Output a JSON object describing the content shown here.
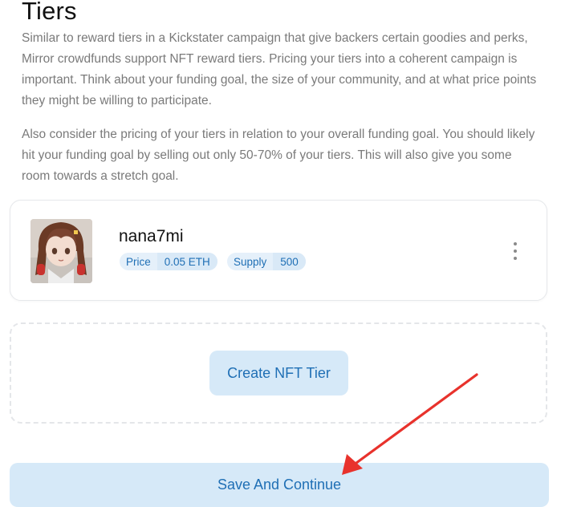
{
  "page": {
    "title": "Tiers",
    "paragraph_1": "Similar to reward tiers in a Kickstater campaign that give backers certain goodies and perks, Mirror crowdfunds support NFT reward tiers. Pricing your tiers into a coherent campaign is important. Think about your funding goal, the size of your community, and at what price points they might be willing to participate.",
    "paragraph_2": "Also consider the pricing of your tiers in relation to your overall funding goal. You should likely hit your funding goal by selling out only 50-70% of your tiers. This will also give you some room towards a stretch goal."
  },
  "tier": {
    "name": "nana7mi",
    "price_label": "Price",
    "price_value": "0.05 ETH",
    "supply_label": "Supply",
    "supply_value": "500",
    "menu_icon": "kebab-menu-icon"
  },
  "actions": {
    "create_tier_label": "Create NFT Tier",
    "save_label": "Save And Continue"
  },
  "annotation": {
    "arrow_color": "#e8322c"
  },
  "colors": {
    "accent": "#1f6fb5",
    "button_bg": "#d6e9f8",
    "pill_bg": "#e5f0fa"
  }
}
